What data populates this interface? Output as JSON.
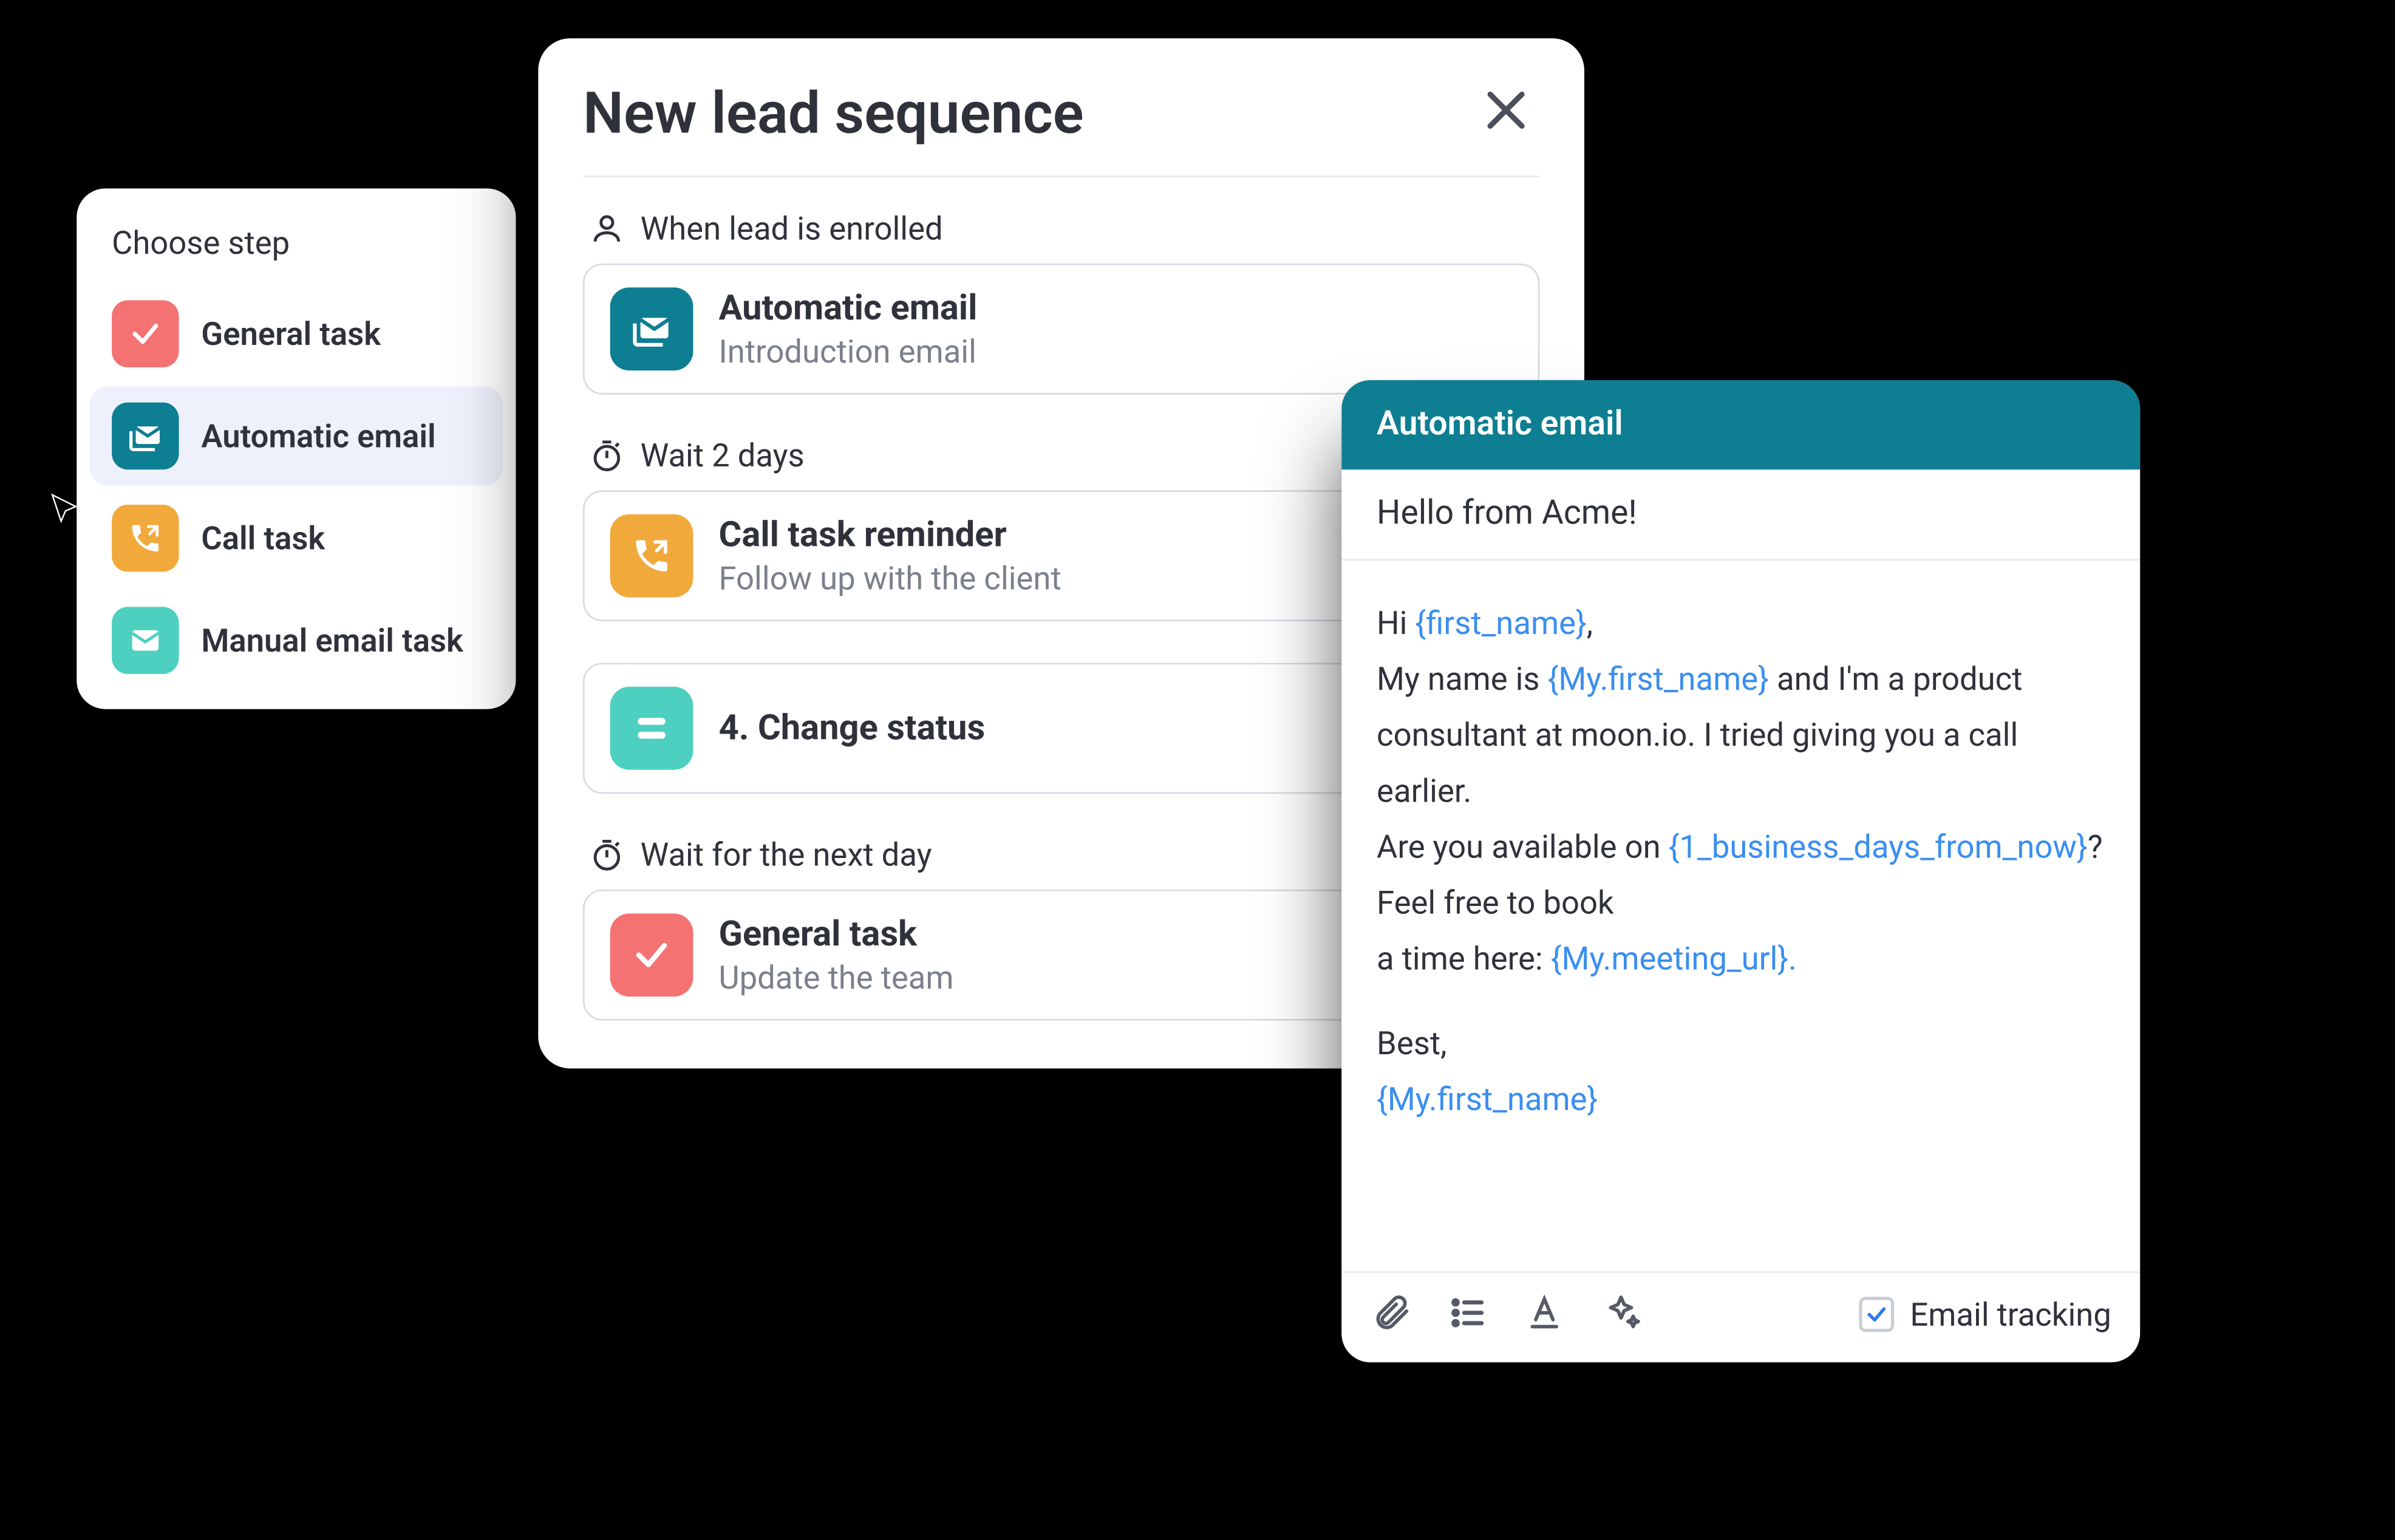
{
  "choose_panel": {
    "title": "Choose step",
    "items": [
      {
        "label": "General task",
        "icon": "check-icon",
        "color": "ic-red",
        "active": false
      },
      {
        "label": "Automatic email",
        "icon": "stacked-mail-icon",
        "color": "ic-teal-d",
        "active": true
      },
      {
        "label": "Call task",
        "icon": "phone-out-icon",
        "color": "ic-orange",
        "active": false
      },
      {
        "label": "Manual email task",
        "icon": "mail-icon",
        "color": "ic-teal",
        "active": false
      }
    ]
  },
  "sequence_panel": {
    "title": "New lead sequence",
    "triggers": [
      {
        "icon": "person-icon",
        "label": "When lead is enrolled",
        "card": {
          "icon": "stacked-mail-icon",
          "color": "ic-teal-d",
          "title": "Automatic email",
          "sub": "Introduction email"
        }
      },
      {
        "icon": "stopwatch-icon",
        "label": "Wait 2 days",
        "card": {
          "icon": "phone-out-icon",
          "color": "ic-orange",
          "title": "Call task reminder",
          "sub": "Follow up with the client"
        }
      },
      {
        "icon": null,
        "label": null,
        "card": {
          "icon": "status-icon",
          "color": "ic-teal",
          "title": "4. Change status",
          "sub": null
        }
      },
      {
        "icon": "stopwatch-icon",
        "label": "Wait for the next day",
        "card": {
          "icon": "check-icon",
          "color": "ic-red",
          "title": "General task",
          "sub": "Update the team"
        }
      }
    ]
  },
  "email_panel": {
    "header": "Automatic email",
    "subject": "Hello from Acme!",
    "body": {
      "l1_a": "Hi ",
      "l1_tok": "{first_name}",
      "l1_b": ",",
      "l2_a": "My name is ",
      "l2_tok": "{My.first_name}",
      "l2_b": " and I'm a product",
      "l3": "consultant at moon.io. I tried giving you a call",
      "l4": "earlier.",
      "l5_a": "Are you available on ",
      "l5_tok": "{1_business_days_from_now}",
      "l5_b": "?",
      "l6": "Feel free to book",
      "l7_a": "a time here: ",
      "l7_tok": "{My.meeting_url}.",
      "l8": "Best,",
      "l9_tok": "{My.first_name}"
    },
    "tracking_label": "Email tracking",
    "tracking_checked": true
  }
}
